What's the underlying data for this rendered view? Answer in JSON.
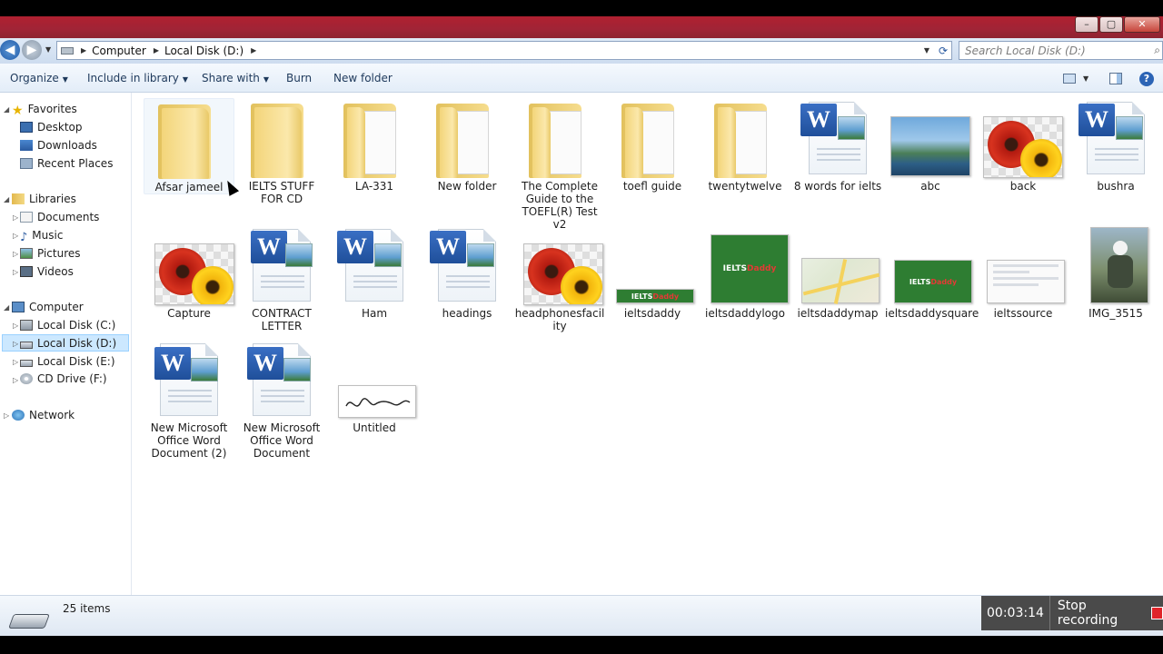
{
  "titlebar": {
    "controls": [
      "–",
      "▢",
      "✕"
    ]
  },
  "address": {
    "segments": [
      "Computer",
      "Local Disk (D:)"
    ]
  },
  "search": {
    "placeholder": "Search Local Disk (D:)"
  },
  "toolbar": {
    "organize": "Organize",
    "include_in_library": "Include in library",
    "share_with": "Share with",
    "burn": "Burn",
    "new_folder": "New folder"
  },
  "sidebar": {
    "favorites": {
      "label": "Favorites",
      "items": [
        "Desktop",
        "Downloads",
        "Recent Places"
      ]
    },
    "libraries": {
      "label": "Libraries",
      "items": [
        "Documents",
        "Music",
        "Pictures",
        "Videos"
      ]
    },
    "computer": {
      "label": "Computer",
      "items": [
        "Local Disk (C:)",
        "Local Disk (D:)",
        "Local Disk (E:)",
        "CD Drive (F:)"
      ]
    },
    "network": {
      "label": "Network"
    }
  },
  "files": [
    {
      "name": "Afsar jameel",
      "type": "folder",
      "selected": true
    },
    {
      "name": "IELTS STUFF FOR CD",
      "type": "folder"
    },
    {
      "name": "LA-331",
      "type": "folder-docs"
    },
    {
      "name": "New folder",
      "type": "folder-docs"
    },
    {
      "name": "The Complete Guide to the TOEFL(R) Test v2",
      "type": "folder-docs"
    },
    {
      "name": "toefl guide",
      "type": "folder-docs"
    },
    {
      "name": "twentytwelve",
      "type": "folder-docs"
    },
    {
      "name": "8 words for ielts",
      "type": "word"
    },
    {
      "name": "abc",
      "type": "image-landscape"
    },
    {
      "name": "back",
      "type": "image-flower"
    },
    {
      "name": "bushra",
      "type": "word"
    },
    {
      "name": "Capture",
      "type": "image-flower"
    },
    {
      "name": "CONTRACT LETTER",
      "type": "word"
    },
    {
      "name": "Ham",
      "type": "word"
    },
    {
      "name": "headings",
      "type": "word"
    },
    {
      "name": "headphonesfacility",
      "type": "image-flower"
    },
    {
      "name": "ieltsdaddy",
      "type": "image-banner"
    },
    {
      "name": "ieltsdaddylogo",
      "type": "image-logo"
    },
    {
      "name": "ieltsdaddymap",
      "type": "image-map"
    },
    {
      "name": "ieltsdaddysquare",
      "type": "image-logo-wide"
    },
    {
      "name": "ieltssource",
      "type": "image-web"
    },
    {
      "name": "IMG_3515",
      "type": "image-photo"
    },
    {
      "name": "New Microsoft Office Word Document (2)",
      "type": "word"
    },
    {
      "name": "New Microsoft Office Word Document",
      "type": "word"
    },
    {
      "name": "Untitled",
      "type": "image-signature"
    }
  ],
  "logo_text": {
    "ielts": "IELTS",
    "daddy": "Daddy"
  },
  "status": {
    "items_count": "25 items"
  },
  "recording": {
    "time": "00:03:14",
    "stop_label": "Stop recording"
  }
}
